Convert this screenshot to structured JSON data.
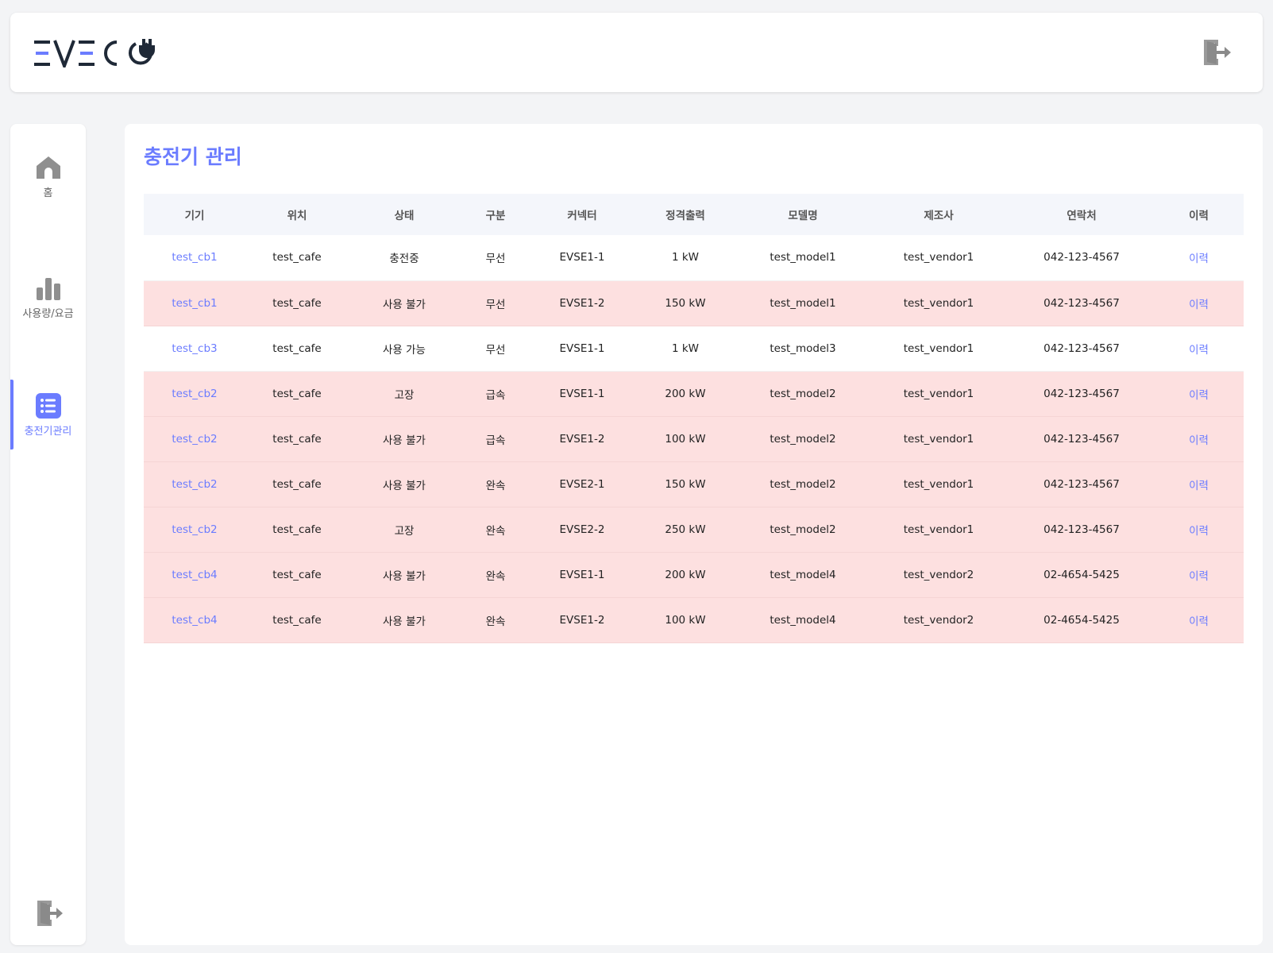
{
  "brand": {
    "logo_text": "EVECO",
    "accent": "#6b7cff",
    "warn_row_bg": "#fde0e0"
  },
  "header": {
    "logout_icon": "logout-icon"
  },
  "sidebar": {
    "items": [
      {
        "label": "홈",
        "icon": "home-icon",
        "active": false
      },
      {
        "label": "사용량/요금",
        "icon": "bar-chart-icon",
        "active": false
      },
      {
        "label": "충전기관리",
        "icon": "list-icon",
        "active": true
      }
    ],
    "logout_icon": "logout-icon"
  },
  "main": {
    "title": "충전기 관리",
    "table": {
      "columns": [
        "기기",
        "위치",
        "상태",
        "구분",
        "커넥터",
        "정격출력",
        "모델명",
        "제조사",
        "연락처",
        "이력"
      ],
      "rows": [
        {
          "highlight": false,
          "cells": [
            "test_cb1",
            "test_cafe",
            "충전중",
            "무선",
            "EVSE1-1",
            "1 kW",
            "test_model1",
            "test_vendor1",
            "042-123-4567",
            "이력"
          ]
        },
        {
          "highlight": true,
          "cells": [
            "test_cb1",
            "test_cafe",
            "사용 불가",
            "무선",
            "EVSE1-2",
            "150 kW",
            "test_model1",
            "test_vendor1",
            "042-123-4567",
            "이력"
          ]
        },
        {
          "highlight": false,
          "cells": [
            "test_cb3",
            "test_cafe",
            "사용 가능",
            "무선",
            "EVSE1-1",
            "1 kW",
            "test_model3",
            "test_vendor1",
            "042-123-4567",
            "이력"
          ]
        },
        {
          "highlight": true,
          "cells": [
            "test_cb2",
            "test_cafe",
            "고장",
            "급속",
            "EVSE1-1",
            "200 kW",
            "test_model2",
            "test_vendor1",
            "042-123-4567",
            "이력"
          ]
        },
        {
          "highlight": true,
          "cells": [
            "test_cb2",
            "test_cafe",
            "사용 불가",
            "급속",
            "EVSE1-2",
            "100 kW",
            "test_model2",
            "test_vendor1",
            "042-123-4567",
            "이력"
          ]
        },
        {
          "highlight": true,
          "cells": [
            "test_cb2",
            "test_cafe",
            "사용 불가",
            "완속",
            "EVSE2-1",
            "150 kW",
            "test_model2",
            "test_vendor1",
            "042-123-4567",
            "이력"
          ]
        },
        {
          "highlight": true,
          "cells": [
            "test_cb2",
            "test_cafe",
            "고장",
            "완속",
            "EVSE2-2",
            "250 kW",
            "test_model2",
            "test_vendor1",
            "042-123-4567",
            "이력"
          ]
        },
        {
          "highlight": true,
          "cells": [
            "test_cb4",
            "test_cafe",
            "사용 불가",
            "완속",
            "EVSE1-1",
            "200 kW",
            "test_model4",
            "test_vendor2",
            "02-4654-5425",
            "이력"
          ]
        },
        {
          "highlight": true,
          "cells": [
            "test_cb4",
            "test_cafe",
            "사용 불가",
            "완속",
            "EVSE1-2",
            "100 kW",
            "test_model4",
            "test_vendor2",
            "02-4654-5425",
            "이력"
          ]
        }
      ]
    }
  }
}
